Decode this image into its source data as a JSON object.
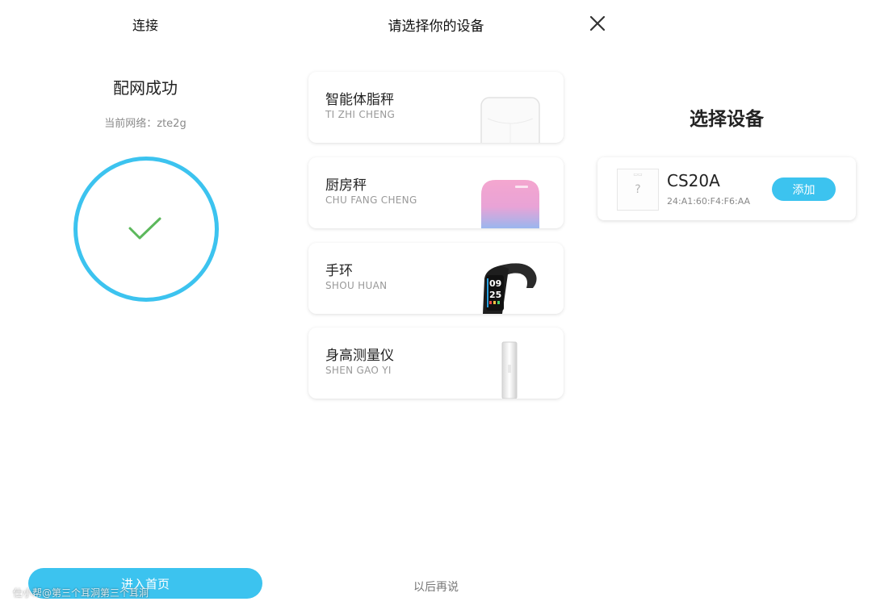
{
  "panel1": {
    "title": "连接",
    "success_text": "配网成功",
    "network_text": "当前网络：zte2g",
    "home_button_label": "进入首页",
    "watermark": "仕小帮@第三个耳洞第三个耳洞",
    "accent_color": "#3cc3ef",
    "check_color": "#5cb85c"
  },
  "panel2": {
    "title": "请选择你的设备",
    "devices": [
      {
        "name": "智能体脂秤",
        "pinyin": "TI ZHI CHENG",
        "icon": "body-fat-scale-image"
      },
      {
        "name": "厨房秤",
        "pinyin": "CHU FANG CHENG",
        "icon": "kitchen-scale-image"
      },
      {
        "name": "手环",
        "pinyin": "SHOU HUAN",
        "icon": "fitness-band-image"
      },
      {
        "name": "身高测量仪",
        "pinyin": "SHEN GAO YI",
        "icon": "height-meter-image"
      }
    ],
    "later_label": "以后再说",
    "band_screen_digits": [
      "09",
      "25"
    ]
  },
  "panel3": {
    "title": "选择设备",
    "device": {
      "name": "CS20A",
      "mac": "24:A1:60:F4:F6:AA",
      "placeholder_glyph": "?",
      "add_label": "添加"
    }
  }
}
